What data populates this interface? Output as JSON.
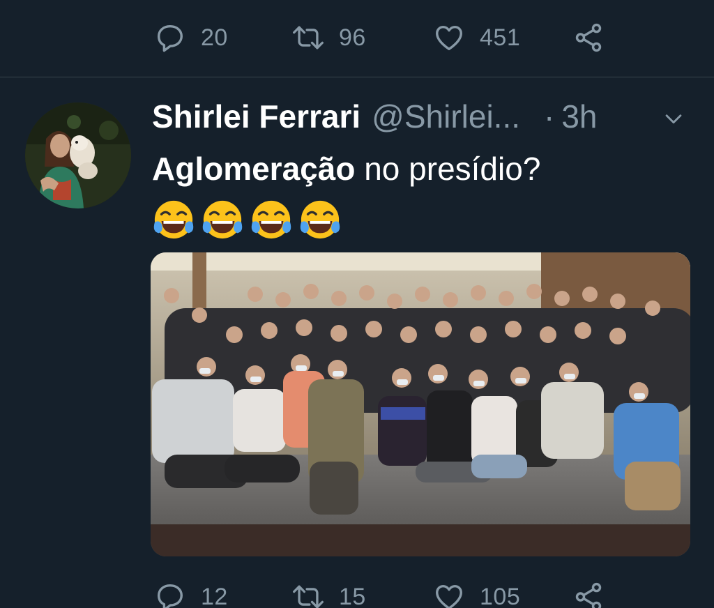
{
  "previous_tweet": {
    "reply_count": "20",
    "retweet_count": "96",
    "like_count": "451"
  },
  "tweet": {
    "author_name": "Shirlei Ferrari",
    "author_handle": "@Shirlei...",
    "separator": "·",
    "time": "3h",
    "text_bold": "Aglomeração",
    "text_rest": " no presídio?",
    "emoji": [
      "face-with-tears-of-joy",
      "face-with-tears-of-joy",
      "face-with-tears-of-joy",
      "face-with-tears-of-joy"
    ],
    "reply_count": "12",
    "retweet_count": "15",
    "like_count": "105"
  },
  "colors": {
    "background": "#15202b",
    "divider": "#38444d",
    "muted": "#8899a6",
    "text": "#ffffff"
  }
}
